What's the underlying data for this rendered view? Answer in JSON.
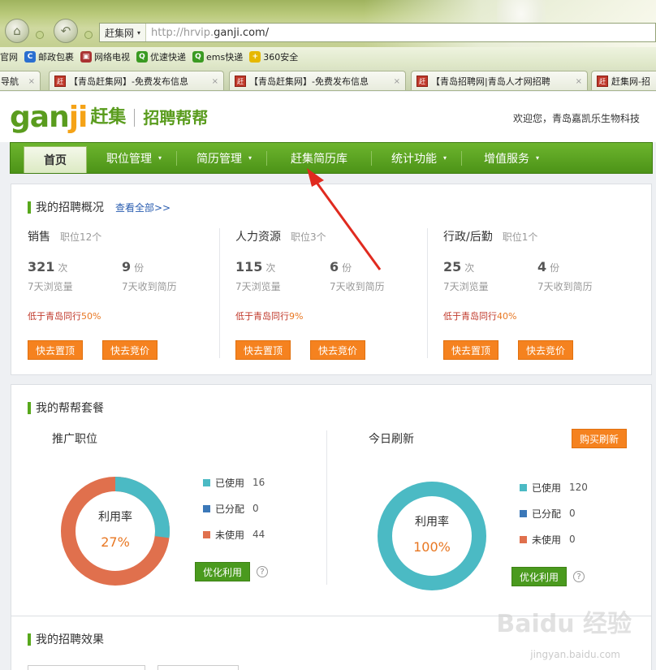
{
  "browser": {
    "site_menu": "赶集网",
    "url_prefix": "http://hrvip.",
    "url_domain": "ganji.com/",
    "favorites": [
      {
        "label": "官网",
        "icon": "",
        "color": ""
      },
      {
        "label": "邮政包裹",
        "icon": "C",
        "color": "#2a6fd0"
      },
      {
        "label": "网络电视",
        "icon": "▣",
        "color": "#a33"
      },
      {
        "label": "优速快递",
        "icon": "Q",
        "color": "#3a9a22"
      },
      {
        "label": "ems快递",
        "icon": "Q",
        "color": "#3a9a22"
      },
      {
        "label": "360安全",
        "icon": "+",
        "color": "#e6b800"
      }
    ],
    "tabs": [
      {
        "label": "导航"
      },
      {
        "label": "【青岛赶集网】-免费发布信息"
      },
      {
        "label": "【青岛赶集网】-免费发布信息"
      },
      {
        "label": "【青岛招聘网|青岛人才网招聘"
      },
      {
        "label": "赶集网-招"
      }
    ],
    "tab_icon_text": "赶"
  },
  "header": {
    "logo_latin_a": "gan",
    "logo_latin_b": "ji",
    "logo_zh": "赶集",
    "logo_sub": "招聘帮帮",
    "welcome": "欢迎您，青岛嘉凯乐生物科技"
  },
  "nav": {
    "items": [
      {
        "label": "首页",
        "active": true
      },
      {
        "label": "职位管理",
        "dropdown": true
      },
      {
        "label": "简历管理",
        "dropdown": true
      },
      {
        "label": "赶集简历库"
      },
      {
        "label": "统计功能",
        "dropdown": true
      },
      {
        "label": "增值服务",
        "dropdown": true
      }
    ],
    "dropdown_glyph": "▾"
  },
  "overview": {
    "title": "我的招聘概况",
    "view_all": "查看全部>>",
    "columns": [
      {
        "name": "销售",
        "count": "职位12个",
        "views": "321",
        "views_unit": "次",
        "views_label": "7天浏览量",
        "resumes": "9",
        "resumes_unit": "份",
        "resumes_label": "7天收到简历",
        "cmp_text": "低于青岛同行",
        "cmp_pct": "50%",
        "btn_top": "快去置顶",
        "btn_bid": "快去竞价"
      },
      {
        "name": "人力资源",
        "count": "职位3个",
        "views": "115",
        "views_unit": "次",
        "views_label": "7天浏览量",
        "resumes": "6",
        "resumes_unit": "份",
        "resumes_label": "7天收到简历",
        "cmp_text": "低于青岛同行",
        "cmp_pct": "9%",
        "btn_top": "快去置顶",
        "btn_bid": "快去竞价"
      },
      {
        "name": "行政/后勤",
        "count": "职位1个",
        "views": "25",
        "views_unit": "次",
        "views_label": "7天浏览量",
        "resumes": "4",
        "resumes_unit": "份",
        "resumes_label": "7天收到简历",
        "cmp_text": "低于青岛同行",
        "cmp_pct": "40%",
        "btn_top": "快去置顶",
        "btn_bid": "快去竞价"
      }
    ]
  },
  "package": {
    "title": "我的帮帮套餐",
    "left": {
      "heading": "推广职位",
      "center_label": "利用率",
      "percent": "27%",
      "fraction": 0.27,
      "legend": [
        {
          "label": "已使用",
          "value": "16",
          "color": "#4bbac4"
        },
        {
          "label": "已分配",
          "value": "0",
          "color": "#3b78b8"
        },
        {
          "label": "未使用",
          "value": "44",
          "color": "#e0704d"
        }
      ],
      "button": "优化利用"
    },
    "right": {
      "heading": "今日刷新",
      "buy_button": "购买刷新",
      "center_label": "利用率",
      "percent": "100%",
      "fraction": 1.0,
      "legend": [
        {
          "label": "已使用",
          "value": "120",
          "color": "#4bbac4"
        },
        {
          "label": "已分配",
          "value": "0",
          "color": "#3b78b8"
        },
        {
          "label": "未使用",
          "value": "0",
          "color": "#e0704d"
        }
      ],
      "button": "优化利用"
    },
    "help_glyph": "?",
    "colors": {
      "used": "#4bbac4",
      "unused": "#e0704d"
    }
  },
  "effect": {
    "title": "我的招聘效果"
  },
  "watermark": {
    "main": "Baidu 经验",
    "sub": "jingyan.baidu.com"
  },
  "annotation": {
    "arrow_color": "#e02a1f"
  }
}
